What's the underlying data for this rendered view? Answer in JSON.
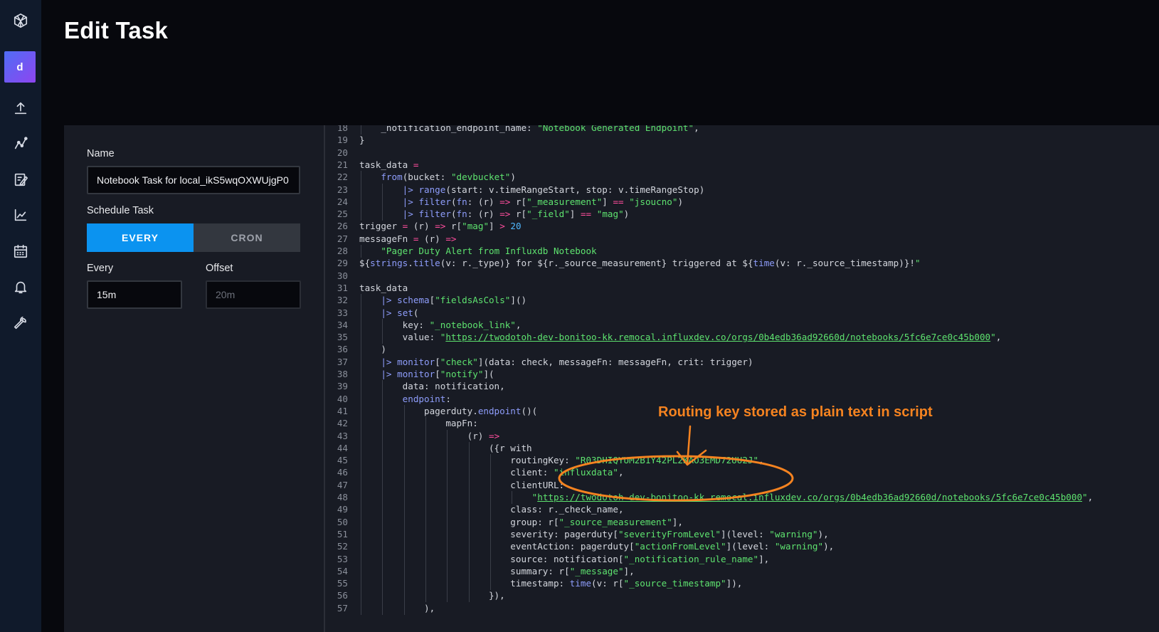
{
  "nav": {
    "org_initial": "d",
    "icons": [
      "influx-logo-icon",
      "upload-icon",
      "data-explorer-icon",
      "notebook-edit-icon",
      "dashboards-chart-icon",
      "tasks-calendar-icon",
      "alerts-bell-icon",
      "settings-wrench-icon"
    ]
  },
  "page": {
    "title": "Edit Task"
  },
  "form": {
    "name_label": "Name",
    "name_value": "Notebook Task for local_ikS5wqOXWUjgP0",
    "schedule_label": "Schedule Task",
    "every_option": "EVERY",
    "cron_option": "CRON",
    "every_label": "Every",
    "every_value": "15m",
    "offset_label": "Offset",
    "offset_placeholder": "20m"
  },
  "editor": {
    "accent_string": "#5ee36f",
    "accent_keyword": "#8e9dfb",
    "accent_operator": "#ff4d9d",
    "lines": [
      {
        "n": "18",
        "t": "    _notification_endpoint_name: \"Notebook Generated Endpoint\","
      },
      {
        "n": "19",
        "t": "}"
      },
      {
        "n": "20",
        "t": ""
      },
      {
        "n": "21",
        "t": "task_data ="
      },
      {
        "n": "22",
        "t": "    from(bucket: \"devbucket\")"
      },
      {
        "n": "23",
        "t": "        |> range(start: v.timeRangeStart, stop: v.timeRangeStop)"
      },
      {
        "n": "24",
        "t": "        |> filter(fn: (r) => r[\"_measurement\"] == \"jsoucno\")"
      },
      {
        "n": "25",
        "t": "        |> filter(fn: (r) => r[\"_field\"] == \"mag\")"
      },
      {
        "n": "26",
        "t": "trigger = (r) => r[\"mag\"] > 20"
      },
      {
        "n": "27",
        "t": "messageFn = (r) =>"
      },
      {
        "n": "28",
        "t": "    \"Pager Duty Alert from Influxdb Notebook"
      },
      {
        "n": "29",
        "t": "${strings.title(v: r._type)} for ${r._source_measurement} triggered at ${time(v: r._source_timestamp)}!\""
      },
      {
        "n": "30",
        "t": ""
      },
      {
        "n": "31",
        "t": "task_data"
      },
      {
        "n": "32",
        "t": "    |> schema[\"fieldsAsCols\"]()"
      },
      {
        "n": "33",
        "t": "    |> set("
      },
      {
        "n": "34",
        "t": "        key: \"_notebook_link\","
      },
      {
        "n": "35",
        "t": "        value: \"https://twodotoh-dev-bonitoo-kk.remocal.influxdev.co/orgs/0b4edb36ad92660d/notebooks/5fc6e7ce0c45b000\","
      },
      {
        "n": "36",
        "t": "    )"
      },
      {
        "n": "37",
        "t": "    |> monitor[\"check\"](data: check, messageFn: messageFn, crit: trigger)"
      },
      {
        "n": "38",
        "t": "    |> monitor[\"notify\"]("
      },
      {
        "n": "39",
        "t": "        data: notification,"
      },
      {
        "n": "40",
        "t": "        endpoint:"
      },
      {
        "n": "41",
        "t": "            pagerduty.endpoint()("
      },
      {
        "n": "42",
        "t": "                mapFn:"
      },
      {
        "n": "43",
        "t": "                    (r) =>"
      },
      {
        "n": "44",
        "t": "                        ({r with"
      },
      {
        "n": "45",
        "t": "                            routingKey: \"R03DHIQYUM2B1Y42PL2KAO3EMD72UU2J\","
      },
      {
        "n": "46",
        "t": "                            client: \"influxdata\","
      },
      {
        "n": "47",
        "t": "                            clientURL:"
      },
      {
        "n": "48",
        "t": "                                \"https://twodotoh-dev-bonitoo-kk.remocal.influxdev.co/orgs/0b4edb36ad92660d/notebooks/5fc6e7ce0c45b000\","
      },
      {
        "n": "49",
        "t": "                            class: r._check_name,"
      },
      {
        "n": "50",
        "t": "                            group: r[\"_source_measurement\"],"
      },
      {
        "n": "51",
        "t": "                            severity: pagerduty[\"severityFromLevel\"](level: \"warning\"),"
      },
      {
        "n": "52",
        "t": "                            eventAction: pagerduty[\"actionFromLevel\"](level: \"warning\"),"
      },
      {
        "n": "53",
        "t": "                            source: notification[\"_notification_rule_name\"],"
      },
      {
        "n": "54",
        "t": "                            summary: r[\"_message\"],"
      },
      {
        "n": "55",
        "t": "                            timestamp: time(v: r[\"_source_timestamp\"]),"
      },
      {
        "n": "56",
        "t": "                        }),"
      },
      {
        "n": "57",
        "t": "            ),"
      }
    ]
  },
  "annotation": {
    "text": "Routing key stored as plain text in script",
    "color": "#f58320"
  }
}
